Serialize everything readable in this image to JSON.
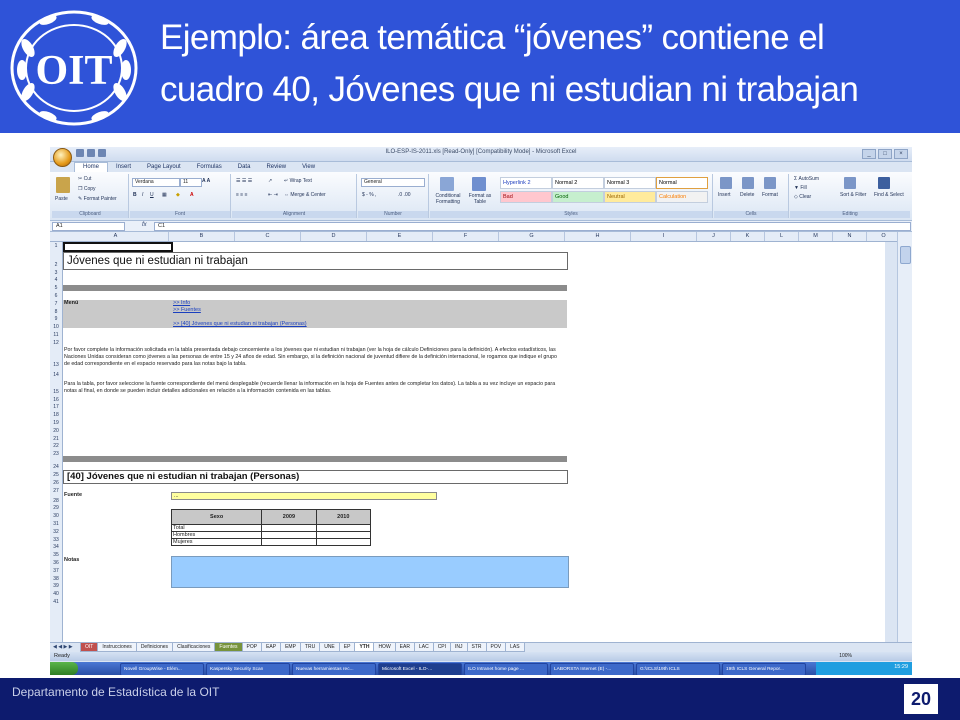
{
  "slide": {
    "title_line1": "Ejemplo: área temática “jóvenes” contiene el",
    "title_line2": "cuadro 40,  Jóvenes que ni estudian ni trabajan",
    "logo_text": "OIT",
    "footer_text": "Departamento de Estadística de la OIT",
    "page_number": "20"
  },
  "excel": {
    "window_title": "ILO-ESP-IS-2011.xls  [Read-Only]  [Compatibility Mode] - Microsoft Excel",
    "tabs": [
      "Home",
      "Insert",
      "Page Layout",
      "Formulas",
      "Data",
      "Review",
      "View"
    ],
    "active_tab": "Home",
    "ribbon": {
      "clipboard": {
        "label": "Clipboard",
        "paste": "Paste",
        "cut": "Cut",
        "copy": "Copy",
        "format_painter": "Format Painter"
      },
      "font": {
        "label": "Font",
        "font_name": "Verdana",
        "font_size": "11"
      },
      "alignment": {
        "label": "Alignment",
        "wrap_text": "Wrap Text",
        "merge_center": "Merge & Center"
      },
      "number": {
        "label": "Number",
        "format": "General"
      },
      "styles": {
        "label": "Styles",
        "conditional_formatting": "Conditional Formatting",
        "format_as_table": "Format as Table",
        "cells": [
          {
            "name": "Hyperlink 2",
            "bg": "#ffffff",
            "color": "#1f3fbf"
          },
          {
            "name": "Normal 2",
            "bg": "#ffffff",
            "color": "#000000"
          },
          {
            "name": "Normal 3",
            "bg": "#ffffff",
            "color": "#000000"
          },
          {
            "name": "Normal",
            "bg": "#ffffff",
            "color": "#000000"
          },
          {
            "name": "Bad",
            "bg": "#ffc7ce",
            "color": "#9c0006"
          },
          {
            "name": "Good",
            "bg": "#c6efce",
            "color": "#006100"
          },
          {
            "name": "Neutral",
            "bg": "#ffeb9c",
            "color": "#9c6500"
          },
          {
            "name": "Calculation",
            "bg": "#f2f2f2",
            "color": "#fa7d00"
          }
        ]
      },
      "cells": {
        "label": "Cells",
        "insert": "Insert",
        "delete": "Delete",
        "format": "Format"
      },
      "editing": {
        "label": "Editing",
        "autosum": "AutoSum",
        "fill": "Fill",
        "clear": "Clear",
        "sort_filter": "Sort & Filter",
        "find_select": "Find & Select"
      }
    },
    "name_box": "A1",
    "formula_label": "fx",
    "formula_value": "C1",
    "columns": [
      "A",
      "B",
      "C",
      "D",
      "E",
      "F",
      "G",
      "H",
      "I",
      "J",
      "K",
      "L",
      "M",
      "N",
      "O"
    ],
    "rows": [
      "1",
      "2",
      "3",
      "4",
      "5",
      "6",
      "7",
      "8",
      "9",
      "10",
      "11",
      "12",
      "13",
      "14",
      "15",
      "16",
      "17",
      "18",
      "19",
      "20",
      "21",
      "22",
      "23",
      "24",
      "25",
      "26",
      "27",
      "28",
      "29",
      "30",
      "31",
      "32",
      "33",
      "34",
      "35",
      "36",
      "37",
      "38",
      "39",
      "40",
      "41"
    ],
    "sheet": {
      "title": "Jóvenes que ni estudian ni trabajan",
      "menu_label": "Menú",
      "menu_links": [
        ">> Info",
        ">> Fuentes",
        ">> [40] Jóvenes que ni estudian ni trabajan (Personas)"
      ],
      "para1": "Por favor complete la información solicitada en la tabla presentada debajo concerniente a los jóvenes que ni estudian ni trabajan (ver la hoja de cálculo Definiciones para la definición). A efectos estadísticos, las Naciones Unidas consideran como jóvenes a las personas de entre 15 y 24 años de edad. Sin embargo, si la definición nacional de juventud difiere de la definición internacional, le rogamos que indique el grupo de edad correspondiente en el espacio reservado para las notas bajo la tabla.",
      "para2": "Para la tabla, por favor seleccione la fuente correspondiente del menú desplegable (recuerde llenar la información en la hoja de Fuentes antes de completar los datos). La tabla a su vez incluye un espacio para notas al final, en donde se pueden incluir detalles adicionales en relación a la información contenida en las tablas.",
      "table_title": "[40] Jóvenes que ni estudian ni trabajan (Personas)",
      "fuente_label": "Fuente",
      "fuente_value": "...",
      "table": {
        "headers": [
          "Sexo",
          "2009",
          "2010"
        ],
        "rows": [
          "Total",
          "Hombres",
          "Mujeres"
        ]
      },
      "notas_label": "Notas"
    },
    "sheet_tabs": [
      {
        "label": "OIT",
        "style": "red"
      },
      {
        "label": "Instrucciones",
        "style": "normal"
      },
      {
        "label": "Definiciones",
        "style": "normal"
      },
      {
        "label": "Clasificaciones",
        "style": "normal"
      },
      {
        "label": "Fuentes",
        "style": "green"
      },
      {
        "label": "POP",
        "style": "normal"
      },
      {
        "label": "EAP",
        "style": "normal"
      },
      {
        "label": "EMP",
        "style": "normal"
      },
      {
        "label": "TRU",
        "style": "normal"
      },
      {
        "label": "UNE",
        "style": "normal"
      },
      {
        "label": "EP",
        "style": "normal"
      },
      {
        "label": "YTH",
        "style": "active"
      },
      {
        "label": "HOW",
        "style": "normal"
      },
      {
        "label": "EAR",
        "style": "normal"
      },
      {
        "label": "LAC",
        "style": "normal"
      },
      {
        "label": "CPI",
        "style": "normal"
      },
      {
        "label": "INJ",
        "style": "normal"
      },
      {
        "label": "STR",
        "style": "normal"
      },
      {
        "label": "POV",
        "style": "normal"
      },
      {
        "label": "LAS",
        "style": "normal"
      }
    ],
    "status": "Ready",
    "zoom": "100%",
    "taskbar_items": [
      "Novell GroupWise - Elém...",
      "Kaspersky Security Scan",
      "Nuevas herramientas rec...",
      "Microsoft Excel - ILO-...",
      "ILO Intranet home page ...",
      "LABORSTA Internet (E) -...",
      "G:\\ICLS\\19th ICLS",
      "19th ICLS General Repor..."
    ],
    "active_taskbar_item": "Microsoft Excel - ILO-...",
    "clock": "15:29"
  }
}
